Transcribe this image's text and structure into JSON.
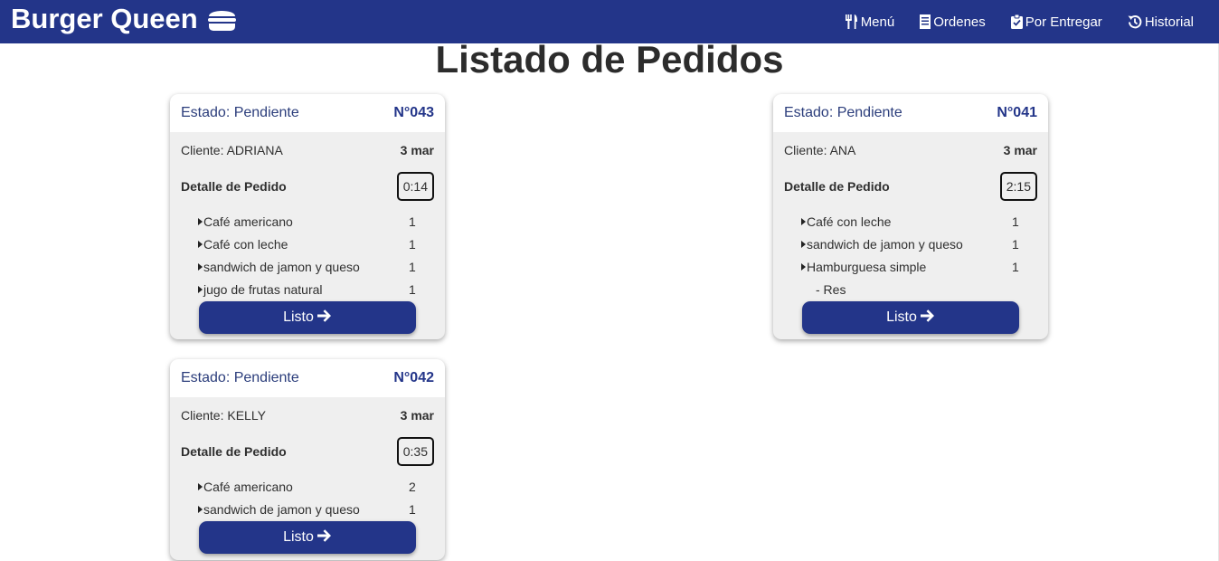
{
  "app": {
    "brand": "Burger Queen",
    "brand_icon": "burger-icon"
  },
  "nav": {
    "items": [
      {
        "label": "Menú",
        "icon": "utensils-icon"
      },
      {
        "label": "Ordenes",
        "icon": "receipt-icon"
      },
      {
        "label": "Por Entregar",
        "icon": "clipboard-check-icon"
      },
      {
        "label": "Historial",
        "icon": "history-icon"
      }
    ]
  },
  "main": {
    "title": "Listado de Pedidos"
  },
  "orders": [
    {
      "estado": "Estado: Pendiente",
      "numero": "N°043",
      "cliente": "Cliente: ADRIANA",
      "fecha": "3 mar",
      "detalle_label": "Detalle de Pedido",
      "timer": "0:14",
      "items": [
        {
          "name": "Café americano",
          "qty": "1"
        },
        {
          "name": "Café con leche",
          "qty": "1"
        },
        {
          "name": "sandwich de jamon y queso",
          "qty": "1"
        },
        {
          "name": "jugo de frutas natural",
          "qty": "1"
        }
      ],
      "button": "Listo"
    },
    {
      "estado": "Estado: Pendiente",
      "numero": "N°041",
      "cliente": "Cliente: ANA",
      "fecha": "3 mar",
      "detalle_label": "Detalle de Pedido",
      "timer": "2:15",
      "items": [
        {
          "name": "Café con leche",
          "qty": "1"
        },
        {
          "name": "sandwich de jamon y queso",
          "qty": "1"
        },
        {
          "name": "Hamburguesa simple",
          "qty": "1"
        }
      ],
      "sub_items": [
        "- Res"
      ],
      "button": "Listo"
    },
    {
      "estado": "Estado: Pendiente",
      "numero": "N°042",
      "cliente": "Cliente: KELLY",
      "fecha": "3 mar",
      "detalle_label": "Detalle de Pedido",
      "timer": "0:35",
      "items": [
        {
          "name": "Café americano",
          "qty": "2"
        },
        {
          "name": "sandwich de jamon y queso",
          "qty": "1"
        }
      ],
      "button": "Listo"
    }
  ],
  "colors": {
    "primary": "#233589",
    "card_bg": "#efefef",
    "text": "#2f2f2f"
  }
}
